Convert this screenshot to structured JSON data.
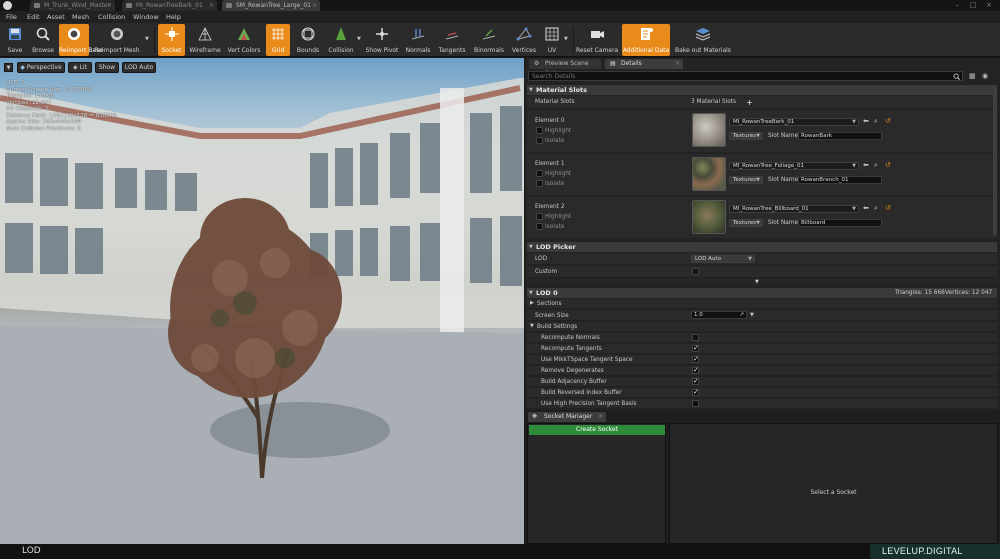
{
  "tabs": [
    {
      "label": "M_Trunk_Wind_Master",
      "active": false
    },
    {
      "label": "MI_RowanTreeBark_01",
      "active": false
    },
    {
      "label": "SM_RowanTree_Large_01",
      "active": true
    }
  ],
  "menu": [
    "File",
    "Edit",
    "Asset",
    "Mesh",
    "Collision",
    "Window",
    "Help"
  ],
  "toolbar": {
    "save": "Save",
    "browse": "Browse",
    "reimport_base": "Reimport Base",
    "reimport_mesh": "Reimport Mesh",
    "socket": "Socket",
    "wireframe": "Wireframe",
    "vert_colors": "Vert Colors",
    "grid": "Grid",
    "bounds": "Bounds",
    "collision": "Collision",
    "show_pivot": "Show Pivot",
    "normals": "Normals",
    "tangents": "Tangents",
    "binormals": "Binormals",
    "vertices": "Vertices",
    "uv": "UV",
    "reset_camera": "Reset Camera",
    "additional_data": "Additional Data",
    "bake_out_materials": "Bake out Materials"
  },
  "viewport": {
    "perspective": "Perspective",
    "lit": "Lit",
    "show": "Show",
    "lod_auto": "LOD Auto",
    "stats": [
      "LOD: 0",
      "Current Screen Size: 0.536869",
      "Triangles: 15,666",
      "Vertices: 12,047",
      "UV Channels: 2",
      "Distance Field: 128x128x128 = 8380kb",
      "Approx Size: 565x646x599",
      "Num Collision Primitives: 0"
    ]
  },
  "panel_tabs": {
    "preview": "Preview Scene Sett",
    "details": "Details"
  },
  "search": {
    "placeholder": "Search Details"
  },
  "material_slots": {
    "header": "Material Slots",
    "row_label": "Material Slots",
    "count": "3 Material Slots",
    "elements": [
      {
        "label": "Element 0",
        "highlight": "Highlight",
        "isolate": "Isolate",
        "material": "MI_RowanTreeBark_01",
        "textures": "Textures",
        "slot_label": "Slot Name",
        "slot_name": "RowanBark"
      },
      {
        "label": "Element 1",
        "highlight": "Highlight",
        "isolate": "Isolate",
        "material": "MI_RowanTree_Foliage_01",
        "textures": "Textures",
        "slot_label": "Slot Name",
        "slot_name": "RowanBranch_01"
      },
      {
        "label": "Element 2",
        "highlight": "Highlight",
        "isolate": "Isolate",
        "material": "MI_RowanTree_Billboard_01",
        "textures": "Textures",
        "slot_label": "Slot Name",
        "slot_name": "Billboard"
      }
    ]
  },
  "lod_picker": {
    "header": "LOD Picker",
    "lod_label": "LOD",
    "lod_value": "LOD Auto",
    "custom_label": "Custom"
  },
  "lod0": {
    "header": "LOD 0",
    "triangles": "Triangles: 15 666",
    "vertices": "Vertices: 12 047",
    "sections": "Sections",
    "screen_size_label": "Screen Size",
    "screen_size_value": "1.0",
    "build_settings": "Build Settings",
    "settings": [
      {
        "label": "Recompute Normals",
        "checked": false
      },
      {
        "label": "Recompute Tangents",
        "checked": true
      },
      {
        "label": "Use MikkTSpace Tangent Space",
        "checked": true
      },
      {
        "label": "Remove Degenerates",
        "checked": true
      },
      {
        "label": "Build Adjacency Buffer",
        "checked": true
      },
      {
        "label": "Build Reversed Index Buffer",
        "checked": true
      },
      {
        "label": "Use High Precision Tangent Basis",
        "checked": false
      }
    ]
  },
  "socket_manager": {
    "tab": "Socket Manager",
    "create": "Create Socket",
    "empty": "Select a Socket"
  },
  "status": {
    "lod": "LOD",
    "watermark": "LEVELUP.DIGITAL"
  },
  "colors": {
    "accent": "#e98b1a",
    "create_button": "#2e8b3a"
  }
}
